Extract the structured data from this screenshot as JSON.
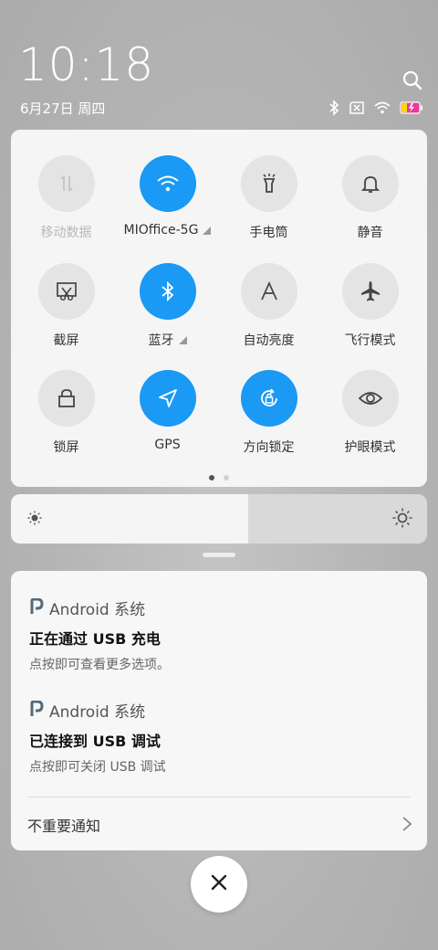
{
  "status": {
    "time": "10:18",
    "date": "6月27日 周四"
  },
  "quick_settings": {
    "tiles": [
      {
        "label": "移动数据",
        "icon": "mobile-data-icon",
        "active": false,
        "disabled": true,
        "has_more": false
      },
      {
        "label": "MIOffice-5G",
        "icon": "wifi-icon",
        "active": true,
        "disabled": false,
        "has_more": true
      },
      {
        "label": "手电筒",
        "icon": "flashlight-icon",
        "active": false,
        "disabled": false,
        "has_more": false
      },
      {
        "label": "静音",
        "icon": "bell-icon",
        "active": false,
        "disabled": false,
        "has_more": false
      },
      {
        "label": "截屏",
        "icon": "screenshot-icon",
        "active": false,
        "disabled": false,
        "has_more": false
      },
      {
        "label": "蓝牙",
        "icon": "bluetooth-icon",
        "active": true,
        "disabled": false,
        "has_more": true
      },
      {
        "label": "自动亮度",
        "icon": "auto-brightness-icon",
        "active": false,
        "disabled": false,
        "has_more": false
      },
      {
        "label": "飞行模式",
        "icon": "airplane-icon",
        "active": false,
        "disabled": false,
        "has_more": false
      },
      {
        "label": "锁屏",
        "icon": "lock-icon",
        "active": false,
        "disabled": false,
        "has_more": false
      },
      {
        "label": "GPS",
        "icon": "gps-icon",
        "active": true,
        "disabled": false,
        "has_more": false
      },
      {
        "label": "方向锁定",
        "icon": "rotation-lock-icon",
        "active": true,
        "disabled": false,
        "has_more": false
      },
      {
        "label": "护眼模式",
        "icon": "eye-icon",
        "active": false,
        "disabled": false,
        "has_more": false
      }
    ],
    "page_count": 2,
    "current_page": 1
  },
  "brightness": {
    "level": 0.57
  },
  "notifications": {
    "items": [
      {
        "app": "Android 系统",
        "title": "正在通过 USB 充电",
        "subtitle": "点按即可查看更多选项。"
      },
      {
        "app": "Android 系统",
        "title": "已连接到 USB 调试",
        "subtitle": "点按即可关闭 USB 调试"
      }
    ],
    "unimportant_label": "不重要通知"
  },
  "colors": {
    "accent": "#1a99f5",
    "tile_off": "#e4e4e4",
    "panel": "#f5f5f5"
  }
}
